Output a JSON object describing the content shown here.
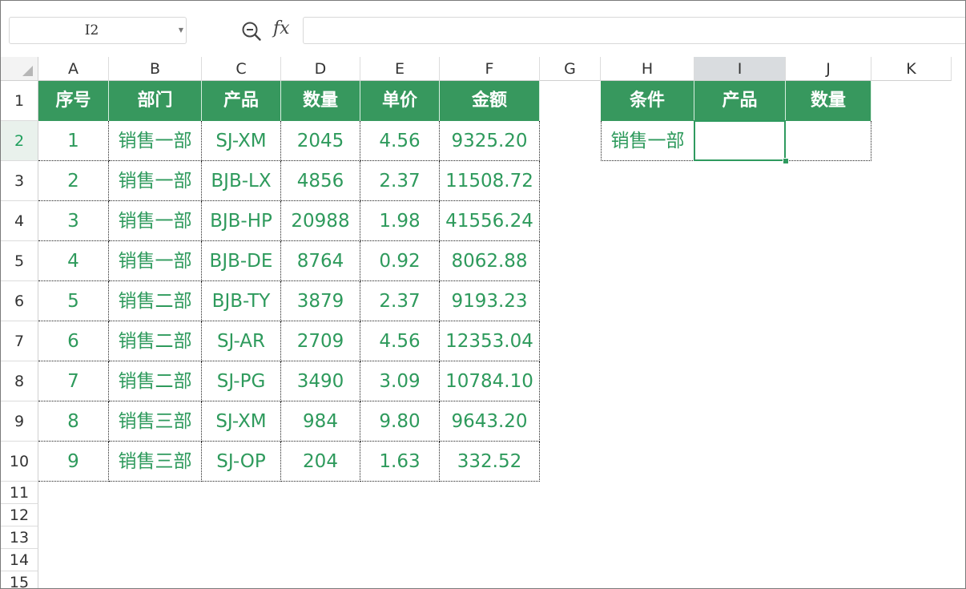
{
  "name_box": {
    "value": "I2",
    "caret_icon": "chevron-down-icon"
  },
  "formula_bar": {
    "zoom_icon": "zoom-icon",
    "fx_label": "fx",
    "value": ""
  },
  "column_headers": [
    "A",
    "B",
    "C",
    "D",
    "E",
    "F",
    "G",
    "H",
    "I",
    "J",
    "K"
  ],
  "row_headers": [
    "1",
    "2",
    "3",
    "4",
    "5",
    "6",
    "7",
    "8",
    "9",
    "10",
    "11",
    "12",
    "13",
    "14",
    "15"
  ],
  "selected_cell": {
    "column": "I",
    "row": "2"
  },
  "main_table": {
    "headers": [
      "序号",
      "部门",
      "产品",
      "数量",
      "单价",
      "金额"
    ],
    "rows": [
      [
        "1",
        "销售一部",
        "SJ-XM",
        "2045",
        "4.56",
        "9325.20"
      ],
      [
        "2",
        "销售一部",
        "BJB-LX",
        "4856",
        "2.37",
        "11508.72"
      ],
      [
        "3",
        "销售一部",
        "BJB-HP",
        "20988",
        "1.98",
        "41556.24"
      ],
      [
        "4",
        "销售一部",
        "BJB-DE",
        "8764",
        "0.92",
        "8062.88"
      ],
      [
        "5",
        "销售二部",
        "BJB-TY",
        "3879",
        "2.37",
        "9193.23"
      ],
      [
        "6",
        "销售二部",
        "SJ-AR",
        "2709",
        "4.56",
        "12353.04"
      ],
      [
        "7",
        "销售二部",
        "SJ-PG",
        "3490",
        "3.09",
        "10784.10"
      ],
      [
        "8",
        "销售三部",
        "SJ-XM",
        "984",
        "9.80",
        "9643.20"
      ],
      [
        "9",
        "销售三部",
        "SJ-OP",
        "204",
        "1.63",
        "332.52"
      ]
    ]
  },
  "criteria_table": {
    "headers": [
      "条件",
      "产品",
      "数量"
    ],
    "row": [
      "销售一部",
      "",
      ""
    ]
  },
  "colors": {
    "header_fill": "#37985e",
    "text_green": "#2e9a5c",
    "selection": "#2f9a5f"
  }
}
